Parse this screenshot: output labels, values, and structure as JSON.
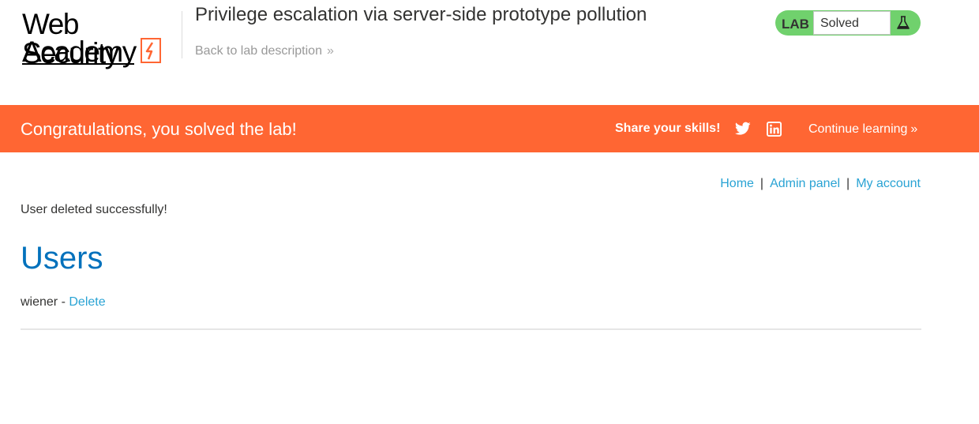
{
  "header": {
    "logo": {
      "line1": "Web Security",
      "line2": "Academy"
    },
    "lab_title": "Privilege escalation via server-side prototype pollution",
    "back_link": "Back to lab description",
    "status": {
      "badge": "LAB",
      "text": "Solved",
      "icon": "flask-icon"
    }
  },
  "banner": {
    "message": "Congratulations, you solved the lab!",
    "share": "Share your skills!",
    "continue": "Continue learning",
    "background": "#ff6633"
  },
  "nav": {
    "home": "Home",
    "admin": "Admin panel",
    "account": "My account",
    "separator": "|"
  },
  "main": {
    "message": "User deleted successfully!",
    "heading": "Users",
    "users": [
      {
        "name": "wiener",
        "separator": "-",
        "action": "Delete"
      }
    ]
  },
  "colors": {
    "accent": "#ff6633",
    "link": "#29a3d4",
    "heading": "#0071bc",
    "solved": "#70d16d"
  }
}
